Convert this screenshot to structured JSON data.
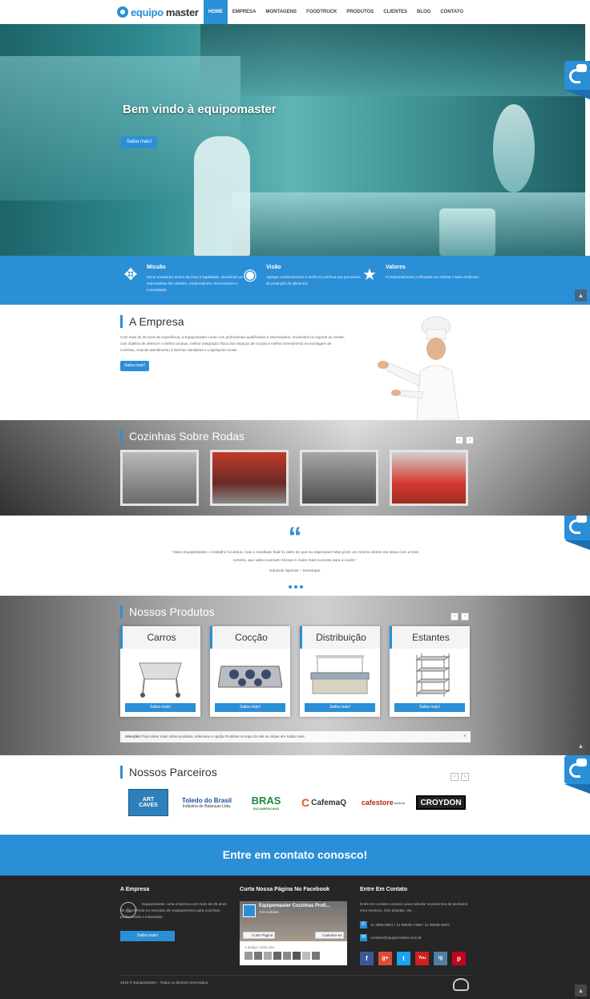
{
  "header": {
    "logo_part1": "equipo",
    "logo_part2": "master",
    "nav": [
      "HOME",
      "EMPRESA",
      "MONTAGENS",
      "FOODTRUCK",
      "PRODUTOS",
      "CLIENTES",
      "BLOG",
      "CONTATO"
    ]
  },
  "hero": {
    "title": "Bem vindo à equipomaster",
    "button": "Saiba mais!"
  },
  "mvv": [
    {
      "title": "Missão",
      "text": "Gerar resultados dentro da ética e legalidade, atendendo as expectativas dos clientes, colaboradores, fornecedores e comunidade.",
      "icon": "target-icon"
    },
    {
      "title": "Visão",
      "text": "Agregar conhecimentos e melhora contínua aos processos de produção de alimentos.",
      "icon": "eye-icon"
    },
    {
      "title": "Valores",
      "text": "Comprometimento e Respeito ao Cliente e Meio Ambiente.",
      "icon": "star-icon"
    }
  ],
  "empresa": {
    "title": "A Empresa",
    "text": "Com mais de 25 anos de experiência, a Equipomaster conta com profissionais qualificados e interessados, envolvidos no suporte ao cliente, com objetivo de oferecer o melhor produto, melhor integração física dos espaços de cocção e melhor investimento na montagem de cozinhas, visando atendimento à Normas Sanitárias e Legislações locais.",
    "button": "Saiba mais!"
  },
  "rodas": {
    "title": "Cozinhas Sobre Rodas",
    "prev": "‹",
    "next": "›"
  },
  "testimonial": {
    "quote": "\"Valeu EquipoMaster, o trabalho foi árduo, mas o resultado final foi além do que eu esperava!!! Mas já ter um retorno desse me deixa com a total certeza, que valeu a pena!!! Abraço e muito mais sucesso para a vocês.\"",
    "author": "Eduardo Spizzas – Developer"
  },
  "produtos": {
    "title": "Nossos Produtos",
    "prev": "‹",
    "next": "›",
    "cards": [
      {
        "title": "Carros",
        "button": "Saiba mais!"
      },
      {
        "title": "Cocção",
        "button": "Saiba mais!"
      },
      {
        "title": "Distribuição",
        "button": "Saiba mais!"
      },
      {
        "title": "Estantes",
        "button": "Saiba mais!"
      }
    ],
    "note_bold": "Atenção!",
    "note": " Para saber mais sobre produtos, selecione a opção Produtos no topo do site ou clique em Saiba mais.",
    "note_close": "×"
  },
  "parceiros": {
    "title": "Nossos Parceiros",
    "prev": "‹",
    "next": "›",
    "logos": [
      {
        "line1": "ART",
        "line2": "CAVES"
      },
      {
        "line1": "Toledo do Brasil",
        "line2": "Indústria de Balanças Ltda."
      },
      {
        "line1": "BRAS",
        "line2": "SULAMERICANA"
      },
      {
        "line1": "CafemaQ",
        "line2": ""
      },
      {
        "line1": "cafestore",
        "line2": ".com.br"
      },
      {
        "line1": "CROYDON",
        "line2": ""
      }
    ]
  },
  "cta": "Entre em contato conosco!",
  "footer": {
    "col1_title": "A Empresa",
    "col1_text": "Equipomaster, uma empresa com mais de 25 anos de experiência no mercado de equipamentos para cozinhas profissionais e industriais.",
    "col1_button": "Saiba mais!",
    "col2_title": "Curta Nossa Página No Facebook",
    "fb_name": "Equipomaster Cozinhas Profi...",
    "fb_likes": "723 curtidas",
    "fb_like_btn": "Curtir Página",
    "fb_share_btn": "Cadastre-se",
    "fb_friend": "1 amigo curtiu isso",
    "col3_title": "Entre Em Contato",
    "col3_text": "Entre em contato conosco para solicitar orçamentos de produtos e/ou serviços, tirar dúvidas, etc.",
    "phone": "11 3865-9551 / 11 99638-7498 / 11 99638-6003",
    "email": "contato@equipomaster.com.br",
    "social": [
      "f",
      "g+",
      "t",
      "You",
      "ig",
      "p"
    ],
    "copyright": "2015 © EquipoMaster - Todos os direitos reservados."
  },
  "colors": {
    "accent": "#2b8fd8",
    "footer": "#262626"
  }
}
